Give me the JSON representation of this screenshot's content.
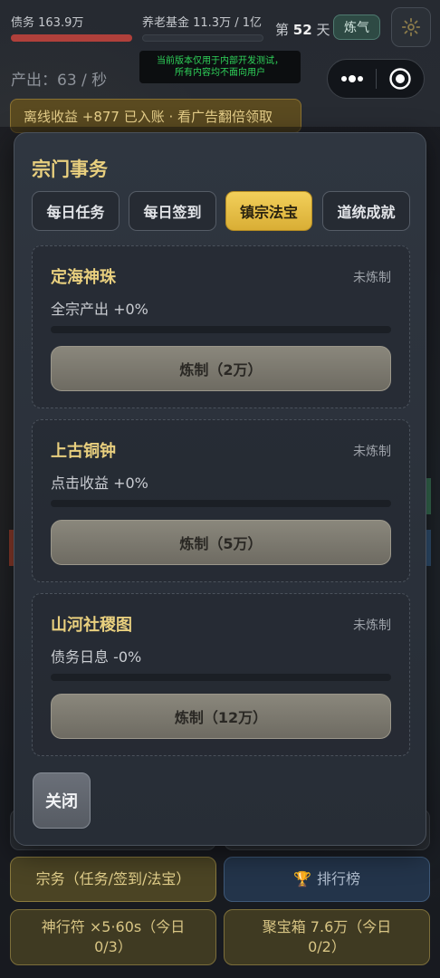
{
  "hud": {
    "debt_label": "债务 163.9万",
    "debt_progress": 1.0,
    "pension_label": "养老基金 11.3万 / 1亿",
    "pension_progress": 0.0,
    "day_prefix": "第",
    "day_number": "52",
    "day_suffix": "天",
    "realm": "炼气",
    "settings_icon": "gear-icon",
    "dev_notice_line1": "当前版本仅用于内部开发测试，",
    "dev_notice_line2": "所有内容均不面向用户",
    "output": "产出：63 / 秒",
    "offline_banner": "离线收益 +877 已入账 · 看广告翻倍领取"
  },
  "bottom": {
    "sect_button": "宗务（任务/签到/法宝）",
    "rank_icon": "trophy-icon",
    "rank_button": "排行榜",
    "talisman_button": "神行符 ×5·60s（今日 0/3）",
    "chest_button": "聚宝箱 7.6万（今日 0/2）"
  },
  "modal": {
    "title": "宗门事务",
    "tabs": [
      {
        "label": "每日任务",
        "active": false
      },
      {
        "label": "每日签到",
        "active": false
      },
      {
        "label": "镇宗法宝",
        "active": true
      },
      {
        "label": "道统成就",
        "active": false
      }
    ],
    "treasures": [
      {
        "name": "定海神珠",
        "status": "未炼制",
        "effect": "全宗产出 +0%",
        "progress": 0.0,
        "button": "炼制（2万）"
      },
      {
        "name": "上古铜钟",
        "status": "未炼制",
        "effect": "点击收益 +0%",
        "progress": 0.0,
        "button": "炼制（5万）"
      },
      {
        "name": "山河社稷图",
        "status": "未炼制",
        "effect": "债务日息 -0%",
        "progress": 0.0,
        "button": "炼制（12万）"
      }
    ],
    "close": "关闭"
  },
  "colors": {
    "accent_gold": "#e8cf7e",
    "active_tab": "#f2cf5a",
    "debt_red": "#b0403b",
    "notice_green": "#2fd35a"
  }
}
